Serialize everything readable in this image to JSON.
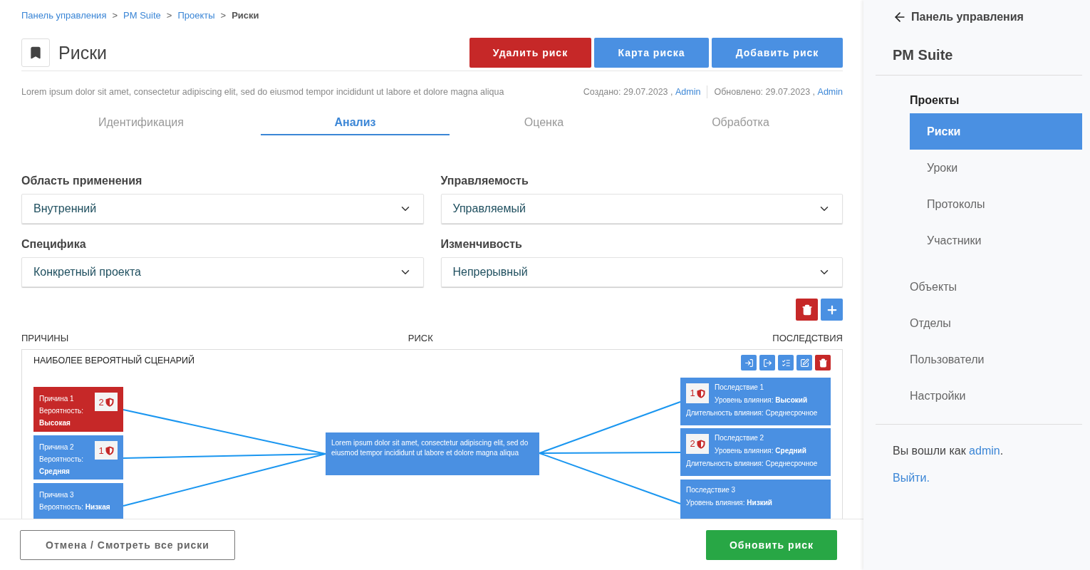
{
  "breadcrumbs": [
    {
      "label": "Панель управления",
      "current": false
    },
    {
      "label": "PM Suite",
      "current": false
    },
    {
      "label": "Проекты",
      "current": false
    },
    {
      "label": "Риски",
      "current": true
    }
  ],
  "breadcrumb_separator": ">",
  "page_title": "Риски",
  "header_buttons": [
    {
      "label": "Удалить риск",
      "kind": "danger"
    },
    {
      "label": "Карта риска",
      "kind": "primary"
    },
    {
      "label": "Добавить риск",
      "kind": "primary"
    }
  ],
  "description": "Lorem ipsum dolor sit amet, consectetur adipiscing elit, sed do eiusmod tempor incididunt ut labore et dolore magna aliqua",
  "meta": {
    "created": "Создано: 29.07.2023 ,",
    "created_by": "Admin",
    "updated": "Обновлено: 29.07.2023 ,",
    "updated_by": "Admin"
  },
  "tabs": [
    {
      "label": "Идентификация",
      "selected": false
    },
    {
      "label": "Анализ",
      "selected": true
    },
    {
      "label": "Оценка",
      "selected": false
    },
    {
      "label": "Обработка",
      "selected": false
    }
  ],
  "fields": [
    {
      "label": "Область применения",
      "value": "Внутренний"
    },
    {
      "label": "Управляемость",
      "value": "Управляемый"
    },
    {
      "label": "Специфика",
      "value": "Конкретный проекта"
    },
    {
      "label": "Изменчивость",
      "value": "Непрерывный"
    }
  ],
  "columns": [
    "ПРИЧИНЫ",
    "РИСК",
    "ПОСЛЕДСТВИЯ"
  ],
  "scenario": {
    "title": "НАИБОЛЕЕ ВЕРОЯТНЫЙ СЦЕНАРИЙ",
    "causes": [
      {
        "title": "Причина 1",
        "probability": "Вероятность: **Высокая**",
        "badge": "2",
        "color": "#c62828"
      },
      {
        "title": "Причина 2",
        "probability": "Вероятность: **Средняя**",
        "badge": "1",
        "color": "#4a90e2"
      },
      {
        "title": "Причина 3",
        "probability": "Вероятность: **Низкая**",
        "color": "#4a90e2"
      }
    ],
    "risk": "Lorem ipsum dolor sit amet, consectetur adipiscing elit, sed do eiusmod tempor incididunt ut labore et dolore magna aliqua",
    "consequences": [
      {
        "title": "Последствие 1",
        "impact": "Уровень влияния: **Высокий**",
        "duration": "Длительность влияния: Среднесрочное",
        "badge": "1"
      },
      {
        "title": "Последствие 2",
        "impact": "Уровень влияния: **Средний**",
        "duration": "Длительность влияния: Среднесрочное",
        "badge": "2"
      },
      {
        "title": "Последствие 3",
        "impact": "Уровень влияния: **Низкий**"
      }
    ]
  },
  "footer_buttons": [
    {
      "label": "Отмена / Смотреть все риски",
      "kind": "outline"
    },
    {
      "label": "Обновить риск",
      "kind": "success"
    }
  ],
  "sidebar": {
    "back": "Панель управления",
    "title": "PM Suite",
    "nav": [
      {
        "label": "Проекты",
        "expanded": true,
        "children": [
          {
            "label": "Риски",
            "selected": true
          },
          {
            "label": "Уроки",
            "selected": false
          },
          {
            "label": "Протоколы",
            "selected": false
          },
          {
            "label": "Участники",
            "selected": false
          }
        ]
      },
      {
        "label": "Объекты",
        "selected": false
      },
      {
        "label": "Отделы",
        "selected": false
      },
      {
        "label": "Пользователи",
        "selected": false
      },
      {
        "label": "Настройки",
        "selected": false
      }
    ],
    "signed_in": "Вы вошли как",
    "user": "admin",
    "signed_in_end": ".",
    "logout": "Выйти."
  }
}
